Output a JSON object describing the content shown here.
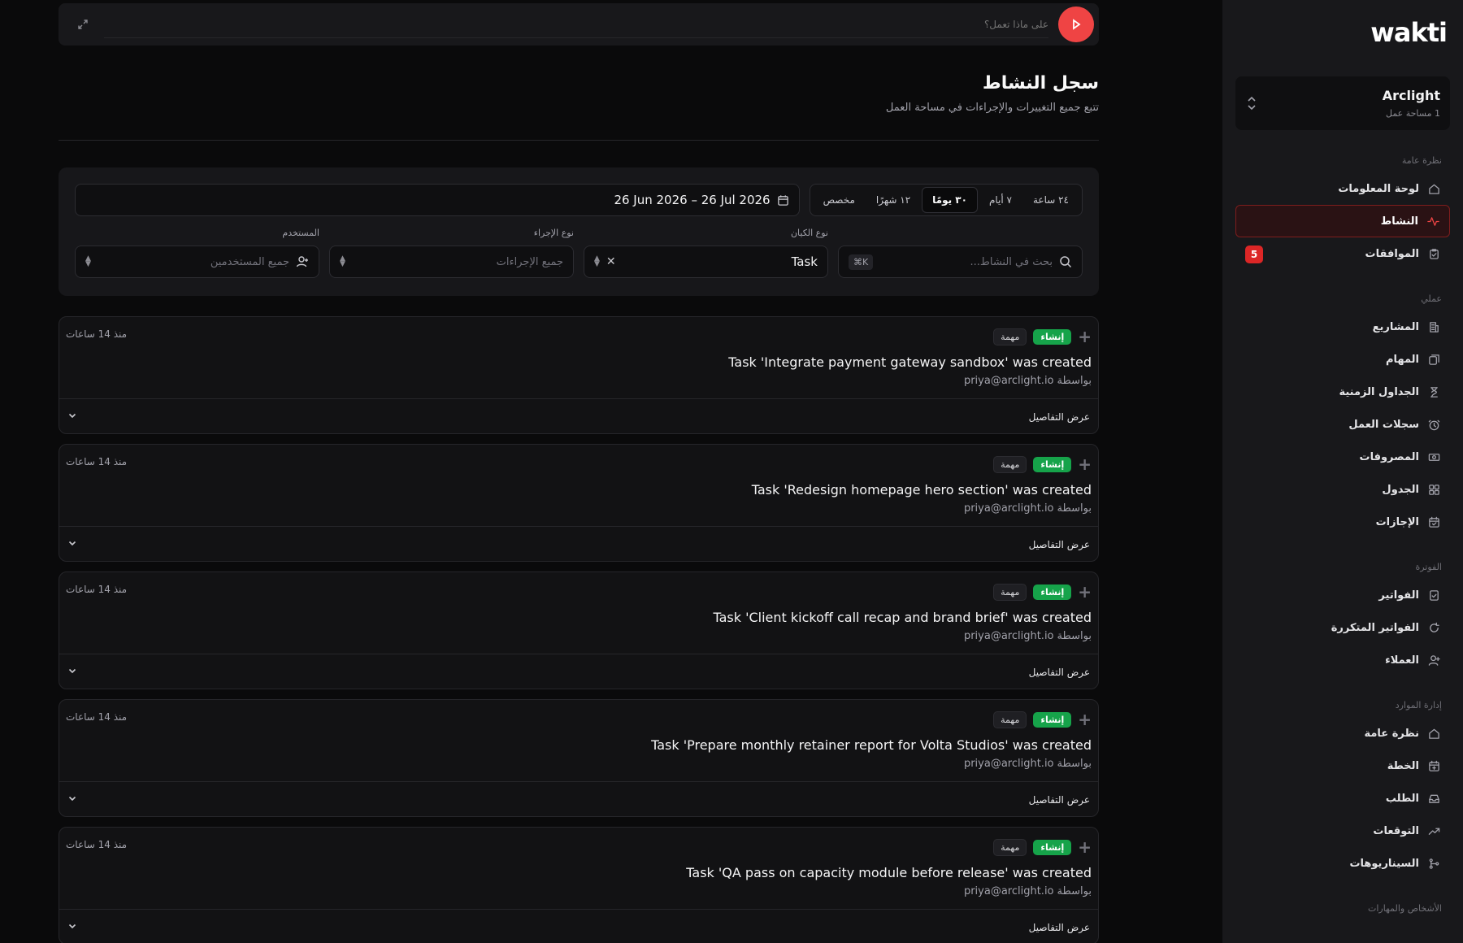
{
  "brand": {
    "logo": "wakti",
    "accent": "#ef4444"
  },
  "workspace": {
    "name": "Arclight",
    "subtitle": "1 مساحة عمل"
  },
  "sidebar": {
    "sections": [
      {
        "title": "نظرة عامة",
        "items": [
          {
            "label": "لوحة المعلومات",
            "icon": "home-icon"
          },
          {
            "label": "النشاط",
            "icon": "activity-icon",
            "active": true
          },
          {
            "label": "الموافقات",
            "icon": "clipboard-check-icon",
            "badge": "5"
          }
        ]
      },
      {
        "title": "عملي",
        "items": [
          {
            "label": "المشاريع",
            "icon": "building-icon"
          },
          {
            "label": "المهام",
            "icon": "tasks-icon"
          },
          {
            "label": "الجداول الزمنية",
            "icon": "hourglass-icon"
          },
          {
            "label": "سجلات العمل",
            "icon": "clock-icon"
          },
          {
            "label": "المصروفات",
            "icon": "banknote-icon"
          },
          {
            "label": "الجدول",
            "icon": "grid-icon"
          },
          {
            "label": "الإجازات",
            "icon": "calendar-icon"
          }
        ]
      },
      {
        "title": "الفوترة",
        "items": [
          {
            "label": "الفواتير",
            "icon": "invoice-icon"
          },
          {
            "label": "الفواتير المتكررة",
            "icon": "refresh-icon"
          },
          {
            "label": "العملاء",
            "icon": "user-plus-icon"
          }
        ]
      },
      {
        "title": "إدارة الموارد",
        "items": [
          {
            "label": "نظرة عامة",
            "icon": "home-icon"
          },
          {
            "label": "الخطة",
            "icon": "calendar-plan-icon"
          },
          {
            "label": "الطلب",
            "icon": "inbox-icon"
          },
          {
            "label": "التوقعات",
            "icon": "trend-icon"
          },
          {
            "label": "السيناريوهات",
            "icon": "branch-icon"
          }
        ]
      },
      {
        "title": "الأشخاص والمهارات",
        "items": []
      }
    ]
  },
  "topbar": {
    "placeholder": "على ماذا تعمل؟"
  },
  "page": {
    "title": "سجل النشاط",
    "subtitle": "تتبع جميع التغييرات والإجراءات في مساحة العمل"
  },
  "filters": {
    "periods": [
      {
        "label": "٢٤ ساعة"
      },
      {
        "label": "٧ أيام"
      },
      {
        "label": "٣٠ يومًا",
        "active": true
      },
      {
        "label": "١٢ شهرًا"
      },
      {
        "label": "مخصص"
      }
    ],
    "date_range": "26 Jun 2026 – 26 Jul 2026",
    "search": {
      "placeholder": "بحث في النشاط...",
      "shortcut": "⌘K"
    },
    "entity": {
      "label": "نوع الكيان",
      "value": "Task"
    },
    "action": {
      "label": "نوع الإجراء",
      "placeholder": "جميع الإجراءات"
    },
    "user": {
      "label": "المستخدم",
      "placeholder": "جميع المستخدمين"
    }
  },
  "activities": [
    {
      "action": "إنشاء",
      "entity": "مهمة",
      "title": "Task 'Integrate payment gateway sandbox' was created",
      "by_prefix": "بواسطة",
      "by": "priya@arclight.io",
      "time": "منذ 14 ساعات",
      "details": "عرض التفاصيل"
    },
    {
      "action": "إنشاء",
      "entity": "مهمة",
      "title": "Task 'Redesign homepage hero section' was created",
      "by_prefix": "بواسطة",
      "by": "priya@arclight.io",
      "time": "منذ 14 ساعات",
      "details": "عرض التفاصيل"
    },
    {
      "action": "إنشاء",
      "entity": "مهمة",
      "title": "Task 'Client kickoff call recap and brand brief' was created",
      "by_prefix": "بواسطة",
      "by": "priya@arclight.io",
      "time": "منذ 14 ساعات",
      "details": "عرض التفاصيل"
    },
    {
      "action": "إنشاء",
      "entity": "مهمة",
      "title": "Task 'Prepare monthly retainer report for Volta Studios' was created",
      "by_prefix": "بواسطة",
      "by": "priya@arclight.io",
      "time": "منذ 14 ساعات",
      "details": "عرض التفاصيل"
    },
    {
      "action": "إنشاء",
      "entity": "مهمة",
      "title": "Task 'QA pass on capacity module before release' was created",
      "by_prefix": "بواسطة",
      "by": "priya@arclight.io",
      "time": "منذ 14 ساعات",
      "details": "عرض التفاصيل"
    }
  ]
}
